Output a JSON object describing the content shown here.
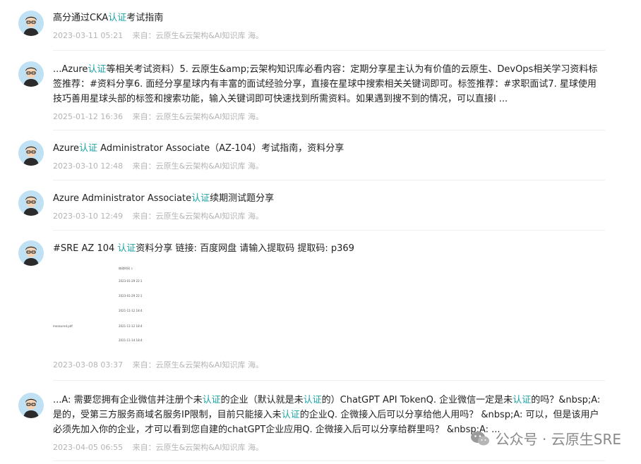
{
  "results": [
    {
      "title_parts": [
        {
          "t": "高分通过CKA"
        },
        {
          "t": "认证",
          "hl": true
        },
        {
          "t": "考试指南"
        }
      ],
      "date": "2023-03-11 05:21",
      "source": "来自：云原生&云架构&AI知识库 海。"
    },
    {
      "title_parts": [
        {
          "t": "...Azure"
        },
        {
          "t": "认证",
          "hl": true
        },
        {
          "t": "等相关考试资料）5. 云原生&amp;云架构知识库必看内容：定期分享星主认为有价值的云原生、DevOps相关学习资料标签推荐：#资料分享6. 面经分享星球内有丰富的面试经验分享，直接在星球中搜索相关关键词即可。标签推荐：#求职面试7. 星球使用技巧善用星球头部的标签和搜索功能，输入关键词即可快速找到所需资料。如果遇到搜不到的情况，可以直接l ..."
        }
      ],
      "date": "2025-01-12 16:36",
      "source": "来自：云原生&云架构&AI知识库 海。"
    },
    {
      "title_parts": [
        {
          "t": "Azure"
        },
        {
          "t": "认证",
          "hl": true
        },
        {
          "t": " Administrator Associate（AZ-104）考试指南，资料分享"
        }
      ],
      "date": "2023-03-10 12:48",
      "source": "来自：云原生&云架构&AI知识库 海。"
    },
    {
      "title_parts": [
        {
          "t": "Azure Administrator Associate"
        },
        {
          "t": "认证",
          "hl": true
        },
        {
          "t": "续期测试题分享"
        }
      ],
      "date": "2023-03-10 12:49",
      "source": "来自：云原生&云架构&AI知识库 海。"
    },
    {
      "title_parts": [
        {
          "t": "#SRE  AZ 104 "
        },
        {
          "t": "认证",
          "hl": true
        },
        {
          "t": "资料分享     链接: 百度网盘 请输入提取码 提取码: p369"
        }
      ],
      "date": "2023-03-08 03:37",
      "source": "来自：云原生&云架构&AI知识库 海。",
      "thumb": {
        "header": "修改时间 ↓",
        "dates": [
          "2023-01-29 22:1",
          "2023-01-29 22:1",
          "2021-11-12 18:4",
          "2021-11-12 18:4",
          "2021-11-14 18:4"
        ],
        "file": "measured.pdf"
      }
    },
    {
      "title_parts": [
        {
          "t": "...A: 需要您拥有企业微信并注册个未"
        },
        {
          "t": "认证",
          "hl": true
        },
        {
          "t": "的企业（默认就是未"
        },
        {
          "t": "认证",
          "hl": true
        },
        {
          "t": "的）ChatGPT API TokenQ. 企业微信一定是未"
        },
        {
          "t": "认证",
          "hl": true
        },
        {
          "t": "的吗？&nbsp;A: 是的，受第三方服务商域名服务IP限制，目前只能接入未"
        },
        {
          "t": "认证",
          "hl": true
        },
        {
          "t": "的企业Q. 企微接入后可以分享给他人用吗？ &nbsp;A: 可以，但是该用户必须先加入你的企业，才可以看到您自建的chatGPT企业应用Q. 企微接入后可以分享给群里吗？ &nbsp;A: ..."
        }
      ],
      "date": "2023-04-05 06:55",
      "source": "来自：云原生&云架构&AI知识库 海。"
    }
  ],
  "watermark": {
    "icon": "wechat-icon",
    "text": "公众号 · 云原生SRE"
  },
  "colors": {
    "highlight": "#1aa3a3",
    "meta": "#b4b4b4",
    "avatar_bg": "#bfe1f3"
  }
}
